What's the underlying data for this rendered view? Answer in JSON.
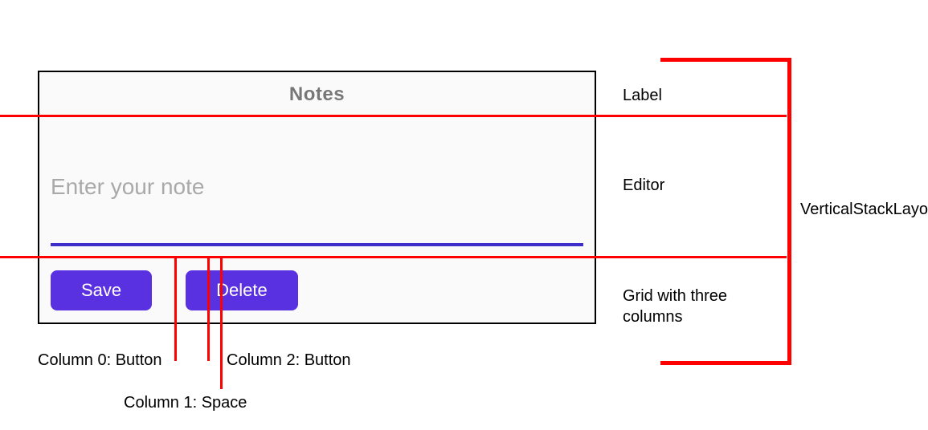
{
  "app": {
    "title": "Notes",
    "editor": {
      "placeholder": "Enter your note"
    },
    "buttons": {
      "save": "Save",
      "delete": "Delete"
    }
  },
  "annotations": {
    "label": "Label",
    "editor": "Editor",
    "grid": "Grid with three columns",
    "container": "VerticalStackLayout",
    "col0": "Column 0: Button",
    "col1": "Column 1: Space",
    "col2": "Column 2: Button"
  }
}
